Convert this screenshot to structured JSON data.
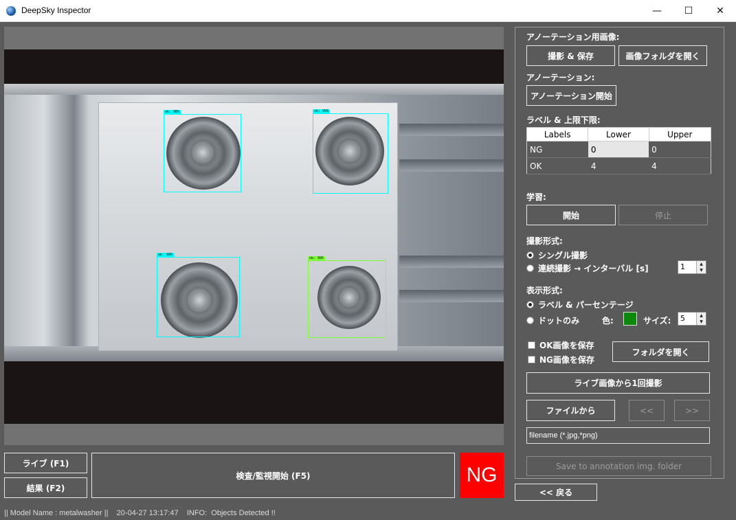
{
  "window": {
    "title": "DeepSky Inspector",
    "min": "—",
    "max": "☐",
    "close": "✕"
  },
  "viewer": {
    "detections": [
      {
        "label": "ok: 98%",
        "color": "#00ffff"
      },
      {
        "label": "ok: 99%",
        "color": "#00ffff"
      },
      {
        "label": "ok: 99%",
        "color": "#00ffff"
      },
      {
        "label": "ok: 99%",
        "color": "#7cff3a"
      }
    ]
  },
  "controls": {
    "live": "ライブ (F1)",
    "result": "結果 (F2)",
    "inspect": "検査/監視開始 (F5)",
    "verdict": "NG",
    "verdict_color": "#ff0000"
  },
  "status": {
    "model": "|| Model Name : metalwasher ||",
    "time": "20-04-27 13:17:47",
    "info": "INFO:  Objects Detected !!"
  },
  "panel": {
    "annot_image": {
      "label": "アノーテーション用画像:",
      "capture_save": "撮影 & 保存",
      "open_folder": "画像フォルダを開く"
    },
    "annotation": {
      "label": "アノーテーション:",
      "start": "アノーテーション開始"
    },
    "label_limits": {
      "label": "ラベル & 上限下限:",
      "headers": [
        "Labels",
        "Lower",
        "Upper"
      ],
      "rows": [
        {
          "name": "NG",
          "lower": "0",
          "upper": "0"
        },
        {
          "name": "OK",
          "lower": "4",
          "upper": "4"
        }
      ]
    },
    "learning": {
      "label": "学習:",
      "start": "開始",
      "stop": "停止"
    },
    "capture_mode": {
      "label": "撮影形式:",
      "single": "シングル撮影",
      "continuous": "連続撮影 → インターバル [s]",
      "interval": "1"
    },
    "display_mode": {
      "label": "表示形式:",
      "label_percent": "ラベル & パーセンテージ",
      "dot_only": "ドットのみ",
      "color_label": "色:",
      "color": "#0a8a0a",
      "size_label": "サイズ:",
      "size": "5"
    },
    "save_options": {
      "save_ok": "OK画像を保存",
      "save_ng": "NG画像を保存",
      "open_folder": "フォルダを開く"
    },
    "capture_once": "ライブ画像から1回撮影",
    "from_file": "ファイルから",
    "prev": "<<",
    "next": ">>",
    "filename": "filename (*.jpg,*png)",
    "save_annotation": "Save to annotation img. folder"
  },
  "back": "<< 戻る"
}
